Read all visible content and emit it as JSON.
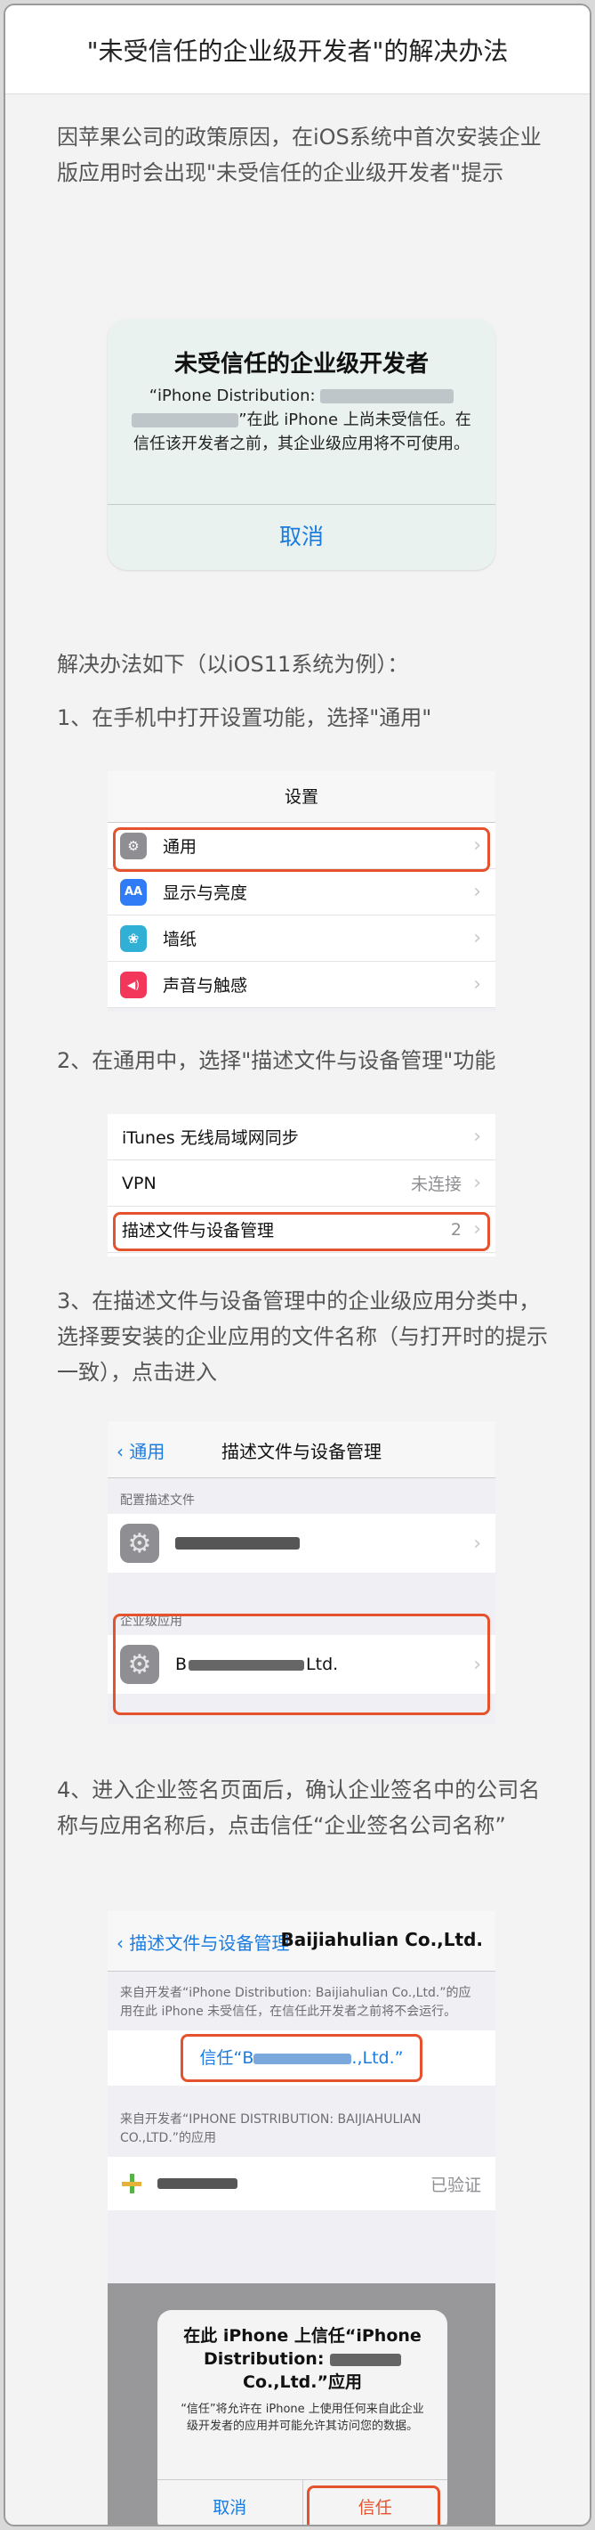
{
  "title": "\"未受信任的企业级开发者\"的解决办法",
  "intro": "因苹果公司的政策原因，在iOS系统中首次安装企业版应用时会出现\"未受信任的企业级开发者\"提示",
  "alert": {
    "title": "未受信任的企业级开发者",
    "body_pre": "“iPhone Distribution: ",
    "body_post": "”在此 iPhone 上尚未受信任。在信任该开发者之前，其企业级应用将不可使用。",
    "cancel": "取消"
  },
  "solution_heading": "解决办法如下（以iOS11系统为例）：",
  "step1": "1、在手机中打开设置功能，选择\"通用\"",
  "shot1": {
    "nav_title": "设置",
    "rows": [
      {
        "label": "通用",
        "icon": "gear-icon",
        "color": "#8e8e93",
        "glyph": "⚙"
      },
      {
        "label": "显示与亮度",
        "icon": "aa-icon",
        "color": "#2f7cf6",
        "glyph": "AA"
      },
      {
        "label": "墙纸",
        "icon": "flower-icon",
        "color": "#31b0d5",
        "glyph": "❀"
      },
      {
        "label": "声音与触感",
        "icon": "speaker-icon",
        "color": "#f2375a",
        "glyph": "◀)"
      }
    ]
  },
  "step2": "2、在通用中，选择\"描述文件与设备管理\"功能",
  "shot2": {
    "rows": [
      {
        "label": "iTunes 无线局域网同步",
        "value": ""
      },
      {
        "label": "VPN",
        "value": "未连接"
      },
      {
        "label": "描述文件与设备管理",
        "value": "2"
      }
    ]
  },
  "step3": "3、在描述文件与设备管理中的企业级应用分类中，选择要安装的企业应用的文件名称（与打开时的提示一致），点击进入",
  "shot3": {
    "back": "通用",
    "nav_title": "描述文件与设备管理",
    "section1": "配置描述文件",
    "section2": "企业级应用",
    "enterprise_name_suffix": "Ltd."
  },
  "step4": "4、进入企业签名页面后，确认企业签名中的公司名称与应用名称后，点击信任“企业签名公司名称”",
  "shot4": {
    "back": "描述文件与设备管理",
    "nav_title": "Baijiahulian Co.,Ltd.",
    "note1": "来自开发者“iPhone Distribution: Baijiahulian Co.,Ltd.”的应用在此 iPhone 未受信任，在信任此开发者之前将不会运行。",
    "trust_pre": "信任“B",
    "trust_post": ".,Ltd.”",
    "note2": "来自开发者“IPHONE DISTRIBUTION: BAIJIAHULIAN CO.,LTD.”的应用",
    "verified": "已验证",
    "dialog_title_pre": "在此 iPhone 上信任“iPhone Distribution: ",
    "dialog_title_post": "Co.,Ltd.”应用",
    "dialog_body": "“信任”将允许在 iPhone 上使用任何来自此企业级开发者的应用并可能允许其访问您的数据。",
    "cancel": "取消",
    "trust": "信任"
  }
}
